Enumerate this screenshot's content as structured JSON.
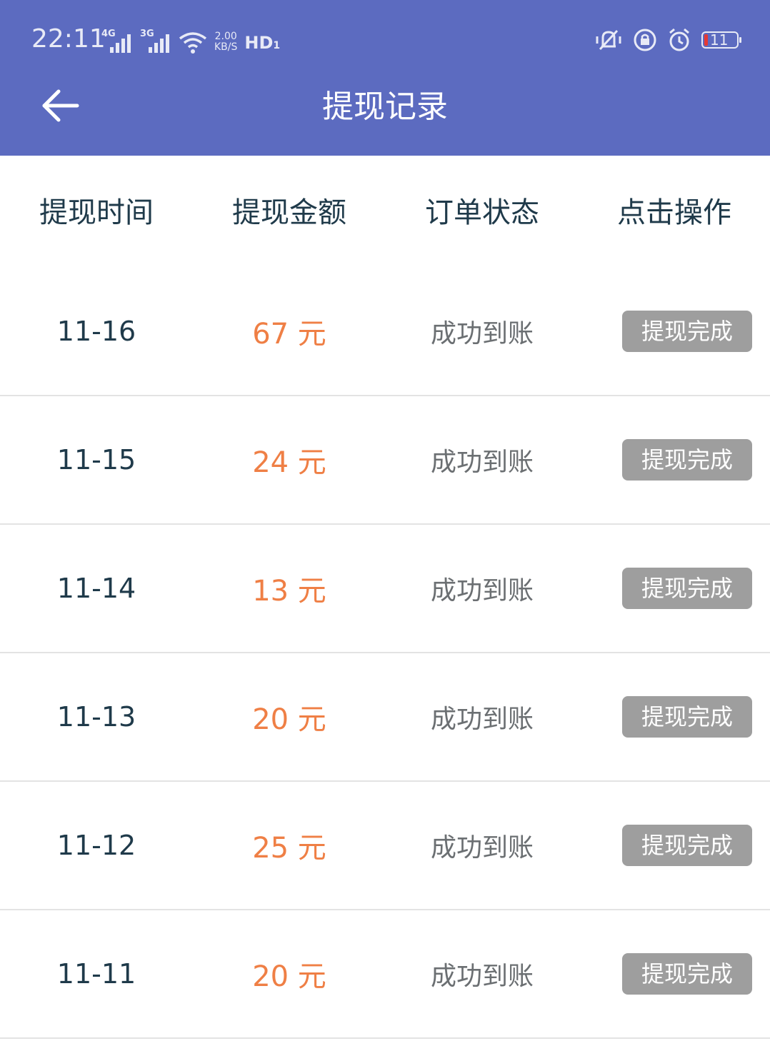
{
  "status_bar": {
    "time": "22:11",
    "net1": "4G",
    "net2": "3G",
    "speed_value": "2.00",
    "speed_unit": "KB/S",
    "hd": "HD",
    "hd_sub": "1",
    "battery": "11",
    "battery_color": "#e53935"
  },
  "header": {
    "title": "提现记录",
    "bg_color": "#5c6bc0"
  },
  "table": {
    "columns": [
      "提现时间",
      "提现金额",
      "订单状态",
      "点击操作"
    ],
    "rows": [
      {
        "date": "11-16",
        "amount": "67 元",
        "status": "成功到账",
        "action": "提现完成"
      },
      {
        "date": "11-15",
        "amount": "24 元",
        "status": "成功到账",
        "action": "提现完成"
      },
      {
        "date": "11-14",
        "amount": "13 元",
        "status": "成功到账",
        "action": "提现完成"
      },
      {
        "date": "11-13",
        "amount": "20 元",
        "status": "成功到账",
        "action": "提现完成"
      },
      {
        "date": "11-12",
        "amount": "25 元",
        "status": "成功到账",
        "action": "提现完成"
      },
      {
        "date": "11-11",
        "amount": "20 元",
        "status": "成功到账",
        "action": "提现完成"
      }
    ]
  },
  "colors": {
    "amount": "#ef7f45",
    "action_button": "#9e9e9e"
  }
}
